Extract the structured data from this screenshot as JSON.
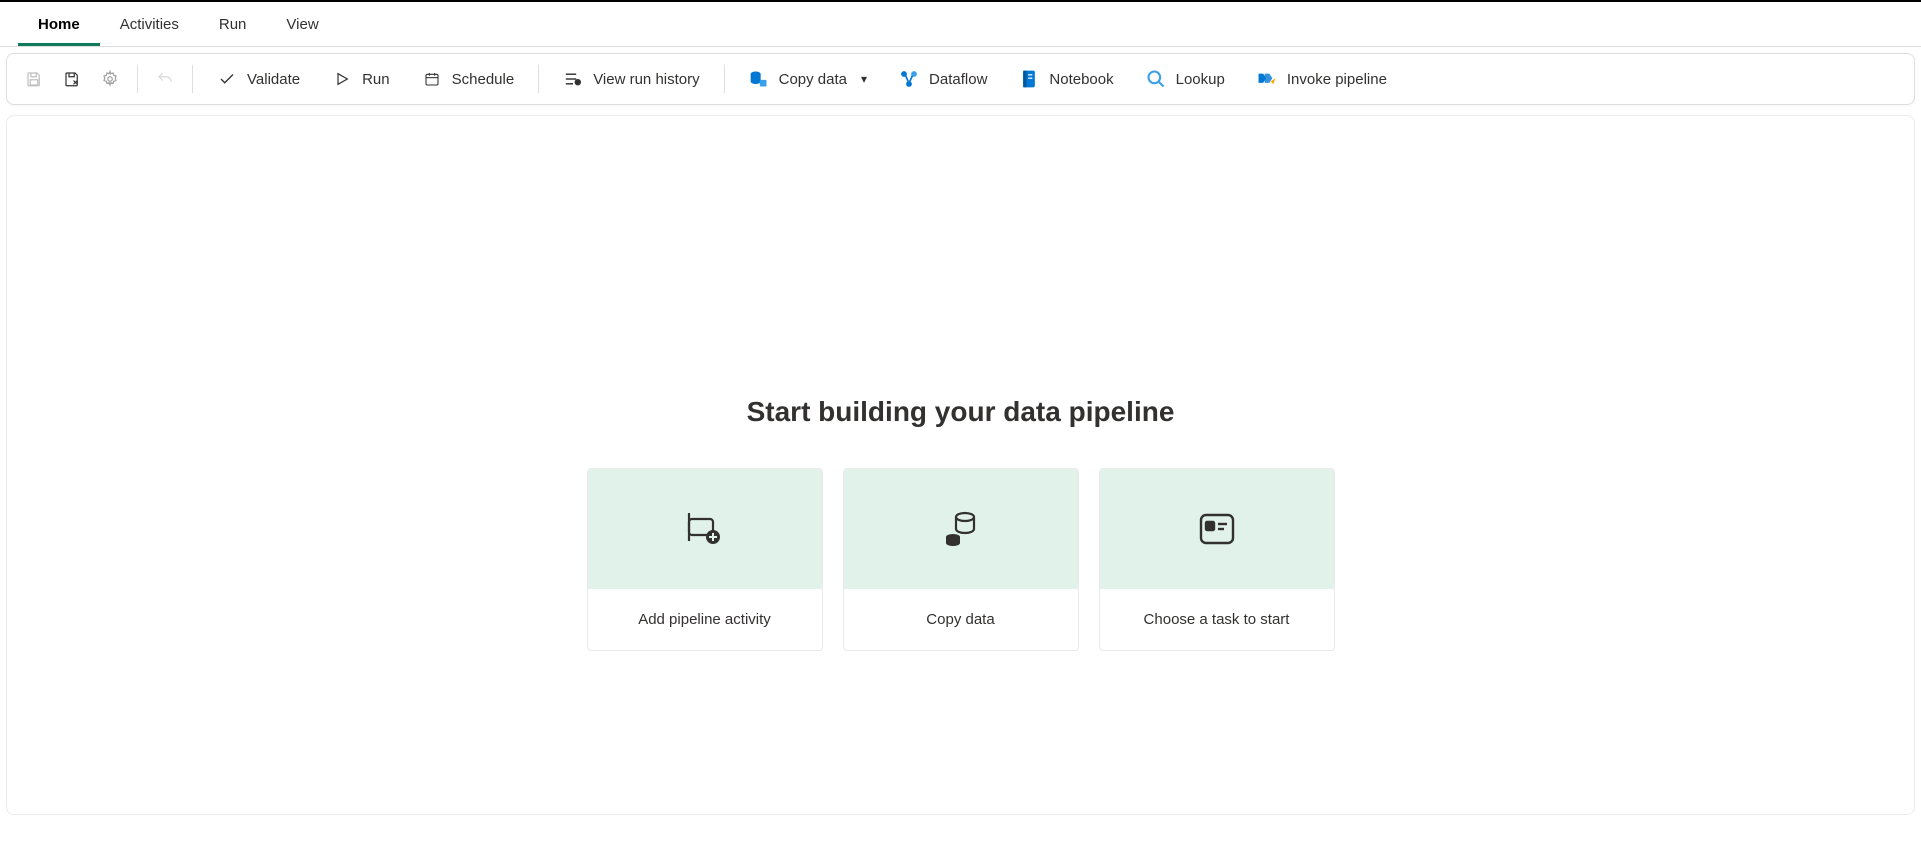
{
  "tabs": [
    "Home",
    "Activities",
    "Run",
    "View"
  ],
  "active_tab": "Home",
  "toolbar": {
    "validate": "Validate",
    "run": "Run",
    "schedule": "Schedule",
    "view_run_history": "View run history",
    "copy_data": "Copy data",
    "dataflow": "Dataflow",
    "notebook": "Notebook",
    "lookup": "Lookup",
    "invoke_pipeline": "Invoke pipeline"
  },
  "main": {
    "headline": "Start building your data pipeline",
    "cards": [
      {
        "label": "Add pipeline activity"
      },
      {
        "label": "Copy data"
      },
      {
        "label": "Choose a task to start"
      }
    ]
  }
}
